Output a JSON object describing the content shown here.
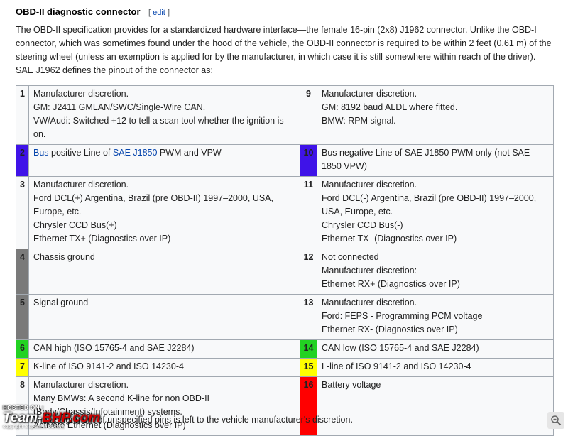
{
  "section": {
    "title": "OBD-II diagnostic connector",
    "edit_open": "[",
    "edit_label": "edit",
    "edit_close": "]"
  },
  "intro": "The OBD-II specification provides for a standardized hardware interface—the female 16-pin (2x8) J1962 connector. Unlike the OBD-I connector, which was sometimes found under the hood of the vehicle, the OBD-II connector is required to be within 2 feet (0.61 m) of the steering wheel (unless an exemption is applied for by the manufacturer, in which case it is still somewhere within reach of the driver). SAE J1962 defines the pinout of the connector as:",
  "pins": [
    {
      "left": {
        "num": "1",
        "color": "#f8f9fa",
        "lines": [
          "Manufacturer discretion.",
          "GM: J2411 GMLAN/SWC/Single-Wire CAN.",
          "VW/Audi: Switched +12 to tell a scan tool whether the ignition is on."
        ]
      },
      "right": {
        "num": "9",
        "color": "#f8f9fa",
        "lines": [
          "Manufacturer discretion.",
          "GM: 8192 baud ALDL where fitted.",
          "BMW: RPM signal."
        ]
      }
    },
    {
      "left": {
        "num": "2",
        "color": "#3f13e8",
        "lines": [],
        "bus_word": "Bus",
        "mid": " positive Line of ",
        "sae_link": "SAE J1850",
        "tail": " PWM and VPW"
      },
      "right": {
        "num": "10",
        "color": "#3f13e8",
        "lines": [
          "Bus negative Line of SAE J1850 PWM only (not SAE 1850 VPW)"
        ]
      }
    },
    {
      "left": {
        "num": "3",
        "color": "#f8f9fa",
        "lines": [
          "Manufacturer discretion.",
          "Ford DCL(+) Argentina, Brazil (pre OBD-II) 1997–2000, USA, Europe, etc.",
          "Chrysler CCD Bus(+)",
          "Ethernet TX+ (Diagnostics over IP)"
        ]
      },
      "right": {
        "num": "11",
        "color": "#f8f9fa",
        "lines": [
          "Manufacturer discretion.",
          "Ford DCL(-) Argentina, Brazil (pre OBD-II) 1997–2000, USA, Europe, etc.",
          "Chrysler CCD Bus(-)",
          "Ethernet TX- (Diagnostics over IP)"
        ]
      }
    },
    {
      "left": {
        "num": "4",
        "color": "#7a7a7a",
        "lines": [
          "Chassis ground"
        ]
      },
      "right": {
        "num": "12",
        "color": "#f8f9fa",
        "lines": [
          "Not connected",
          "Manufacturer discretion:",
          "Ethernet RX+ (Diagnostics over IP)"
        ]
      }
    },
    {
      "left": {
        "num": "5",
        "color": "#7a7a7a",
        "lines": [
          "Signal ground"
        ]
      },
      "right": {
        "num": "13",
        "color": "#f8f9fa",
        "lines": [
          "Manufacturer discretion.",
          "Ford: FEPS - Programming PCM voltage",
          "Ethernet RX- (Diagnostics over IP)"
        ]
      }
    },
    {
      "left": {
        "num": "6",
        "color": "#22d222",
        "lines": [
          "CAN high (ISO 15765-4 and SAE J2284)"
        ]
      },
      "right": {
        "num": "14",
        "color": "#22d222",
        "lines": [
          "CAN low (ISO 15765-4 and SAE J2284)"
        ]
      }
    },
    {
      "left": {
        "num": "7",
        "color": "#ffff00",
        "lines": [
          "K-line of ISO 9141-2 and ISO 14230-4"
        ]
      },
      "right": {
        "num": "15",
        "color": "#ffff00",
        "lines": [
          "L-line of ISO 9141-2 and ISO 14230-4"
        ]
      }
    },
    {
      "left": {
        "num": "8",
        "color": "#f8f9fa",
        "lines": [
          "Manufacturer discretion.",
          "Many BMWs: A second K-line for non OBD-II (Body/Chassis/Infotainment) systems.",
          "Activate Ethernet (Diagnostics over IP)"
        ]
      },
      "right": {
        "num": "16",
        "color": "#ff0000",
        "lines": [
          "Battery voltage"
        ]
      }
    }
  ],
  "footer_note": "The assignment of unspecified pins is left to the vehicle manufacturer's discretion.",
  "watermark": {
    "hosted": "HOSTED ON :",
    "logo_a": "Team-",
    "logo_b": "BHP",
    "logo_c": ".com",
    "copyright": "copyright respective owners"
  },
  "icons": {
    "zoom": "magnifier-zoom-icon"
  }
}
